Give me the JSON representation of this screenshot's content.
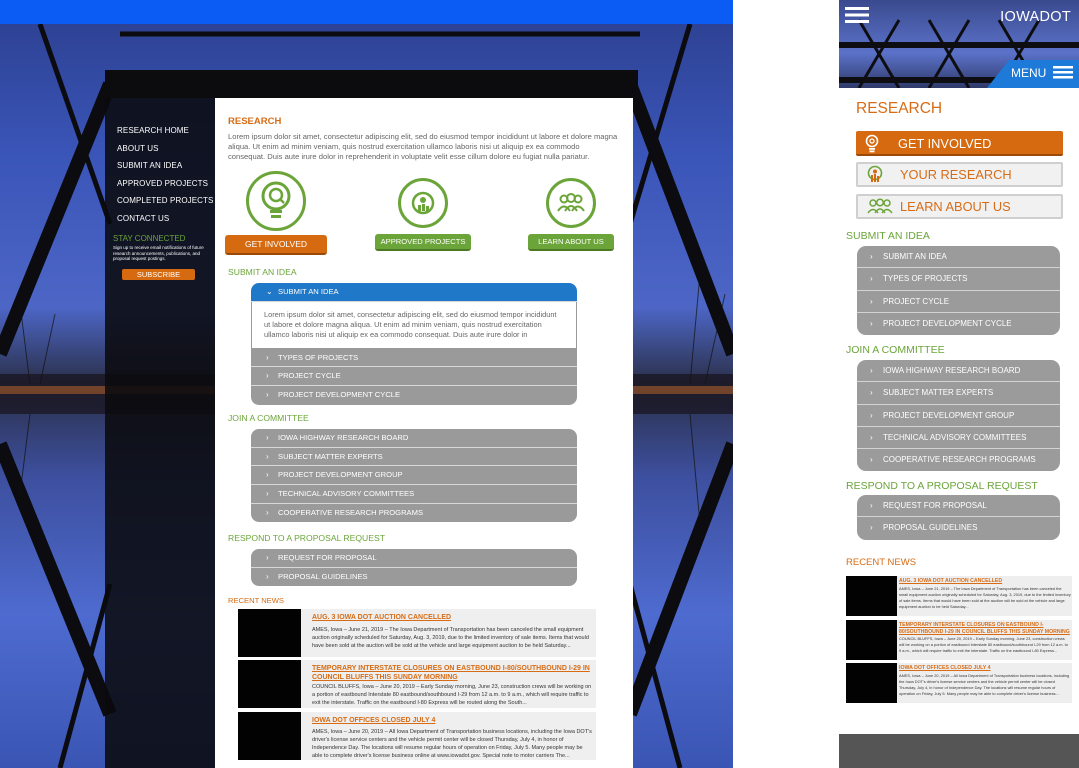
{
  "colors": {
    "orange": "#d66a10",
    "green": "#6ba539",
    "blue": "#1f78c8",
    "grey": "#9a9a9a"
  },
  "desktop": {
    "sidebar": {
      "nav": [
        "RESEARCH HOME",
        "ABOUT US",
        "SUBMIT AN IDEA",
        "APPROVED PROJECTS",
        "COMPLETED PROJECTS",
        "CONTACT US"
      ],
      "stay_title": "STAY CONNECTED",
      "stay_desc": "Sign up to receive email notifications of future research announcements, publications, and proposal request postings.",
      "subscribe": "SUBSCRIBE"
    },
    "main": {
      "title": "RESEARCH",
      "intro": "Lorem ipsum dolor sit amet, consectetur adipiscing elit, sed do eiusmod tempor incididunt ut labore et dolore magna aliqua. Ut enim ad minim veniam, quis nostrud exercitation ullamco laboris nisi ut aliquip ex ea commodo consequat. Duis aute irure dolor in reprehenderit in voluptate velit esse cillum dolore eu fugiat nulla pariatur.",
      "get_involved": "GET INVOLVED",
      "approved": "APPROVED PROJECTS",
      "learn": "LEARN ABOUT US",
      "submit_heading": "SUBMIT AN IDEA",
      "submit_open": "SUBMIT AN IDEA",
      "submit_panel": "Lorem ipsum dolor sit amet, consectetur adipiscing elit, sed do eiusmod tempor incididunt ut labore et dolore magna aliqua. Ut enim ad minim veniam, quis nostrud exercitation ullamco laboris nisi ut aliquip ex ea commodo consequat. Duis aute irure dolor in",
      "submit_rows": [
        "TYPES OF PROJECTS",
        "PROJECT CYCLE",
        "PROJECT DEVELOPMENT CYCLE"
      ],
      "committee_heading": "JOIN A COMMITTEE",
      "committee_rows": [
        "IOWA HIGHWAY RESEARCH BOARD",
        "SUBJECT MATTER EXPERTS",
        "PROJECT DEVELOPMENT GROUP",
        "TECHNICAL ADVISORY COMMITTEES",
        "COOPERATIVE RESEARCH PROGRAMS"
      ],
      "proposal_heading": "RESPOND TO A PROPOSAL REQUEST",
      "proposal_rows": [
        "REQUEST FOR PROPOSAL",
        "PROPOSAL GUIDELINES"
      ],
      "news_heading": "RECENT NEWS",
      "news": [
        {
          "title": "AUG. 3 IOWA DOT AUCTION CANCELLED",
          "body": "AMES, Iowa – June 21, 2019 – The Iowa Department of Transportation has been canceled the small equipment auction originally scheduled for Saturday, Aug. 3, 2019, due to the limited inventory of sale items. Items that would have been sold at the auction will be sold at the vehicle and large equipment auction to be held Saturday..."
        },
        {
          "title": "TEMPORARY INTERSTATE CLOSURES ON EASTBOUND I-80/SOUTHBOUND I-29 IN COUNCIL BLUFFS THIS SUNDAY MORNING",
          "body": "COUNCIL BLUFFS, Iowa – June 20, 2019 – Early Sunday morning, June 23, construction crews will be working on a portion of eastbound Interstate 80 eastbound/southbound I-29 from 12 a.m. to 9 a.m., which will require traffic to exit the interstate. Traffic on the eastbound I-80 Express will be routed along the South..."
        },
        {
          "title": "IOWA DOT OFFICES CLOSED JULY 4",
          "body": "AMES, Iowa – June 20, 2019 – All Iowa Department of Transportation business locations, including the Iowa DOT's driver's license service centers and the vehicle permit center will be closed Thursday, July 4, in honor of Independence Day. The locations will resume regular hours of operation on Friday, July 5. Many people may be able to complete driver's license business online at www.iowadot.gov. Special note to motor carriers The..."
        }
      ]
    }
  },
  "mobile": {
    "brand": "IOWADOT",
    "menu": "MENU",
    "title": "RESEARCH",
    "get_involved": "GET INVOLVED",
    "your_research": "YOUR RESEARCH",
    "learn": "LEARN ABOUT US",
    "submit_heading": "SUBMIT AN IDEA",
    "submit_rows": [
      "SUBMIT AN IDEA",
      "TYPES OF PROJECTS",
      "PROJECT CYCLE",
      "PROJECT DEVELOPMENT CYCLE"
    ],
    "committee_heading": "JOIN A COMMITTEE",
    "committee_rows": [
      "IOWA HIGHWAY RESEARCH BOARD",
      "SUBJECT MATTER EXPERTS",
      "PROJECT DEVELOPMENT GROUP",
      "TECHNICAL ADVISORY COMMITTEES",
      "COOPERATIVE RESEARCH PROGRAMS"
    ],
    "proposal_heading": "RESPOND TO A PROPOSAL REQUEST",
    "proposal_rows": [
      "REQUEST FOR PROPOSAL",
      "PROPOSAL GUIDELINES"
    ],
    "news_heading": "RECENT NEWS",
    "news": [
      {
        "title": "AUG. 3 IOWA DOT AUCTION CANCELLED",
        "body": "AMES, Iowa – June 21, 2019 – The Iowa Department of Transportation has been canceled the small equipment auction originally scheduled for Saturday, Aug. 3, 2019, due to the limited inventory of sale items. Items that would have been sold at the auction will be sold at the vehicle and large equipment auction to be held Saturday..."
      },
      {
        "title": "TEMPORARY INTERSTATE CLOSURES ON EASTBOUND I-80/SOUTHBOUND I-29 IN COUNCIL BLUFFS THIS SUNDAY MORNING",
        "body": "COUNCIL BLUFFS, Iowa – June 20, 2019 – Early Sunday morning, June 23, construction crews will be working on a portion of eastbound Interstate 80 eastbound/southbound I-29 from 12 a.m. to 9 a.m., which will require traffic to exit the interstate. Traffic on the eastbound I-80 Express..."
      },
      {
        "title": "IOWA DOT OFFICES CLOSED JULY 4",
        "body": "AMES, Iowa – June 20, 2019 – All Iowa Department of Transportation business locations, including the Iowa DOT's driver's license service centers and the vehicle permit center will be closed Thursday, July 4, in honor of Independence Day. The locations will resume regular hours of operation on Friday, July 5. Many people may be able to complete driver's license business..."
      }
    ]
  }
}
